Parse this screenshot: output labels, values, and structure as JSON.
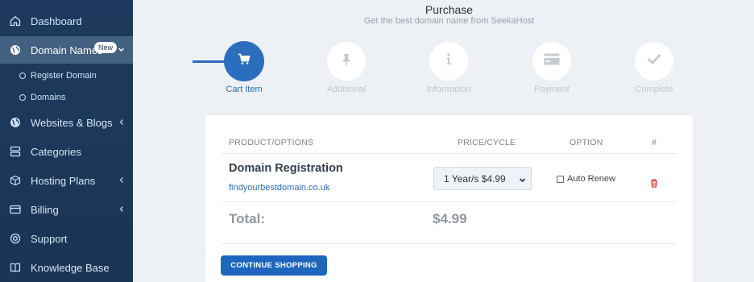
{
  "sidebar": {
    "items": [
      {
        "label": "Dashboard",
        "icon": "home-icon"
      },
      {
        "label": "Domain Names",
        "icon": "globe-icon",
        "badge": "New",
        "active": true
      },
      {
        "label": "Websites & Blogs",
        "icon": "globe-icon"
      },
      {
        "label": "Categories",
        "icon": "server-icon"
      },
      {
        "label": "Hosting Plans",
        "icon": "box-icon"
      },
      {
        "label": "Billing",
        "icon": "card-icon"
      },
      {
        "label": "Support",
        "icon": "lifebuoy-icon"
      },
      {
        "label": "Knowledge Base",
        "icon": "book-icon"
      }
    ],
    "subitems": [
      {
        "label": "Register Domain"
      },
      {
        "label": "Domains"
      }
    ]
  },
  "header": {
    "title": "Purchase",
    "subtitle": "Get the best domain name from SeekaHost"
  },
  "steps": [
    {
      "label": "Cart Item",
      "icon": "cart-icon",
      "active": true
    },
    {
      "label": "Additional",
      "icon": "pin-icon"
    },
    {
      "label": "Information",
      "icon": "info-icon"
    },
    {
      "label": "Payment",
      "icon": "credit-card-icon"
    },
    {
      "label": "Complete",
      "icon": "check-icon"
    }
  ],
  "cart": {
    "headers": {
      "product": "PRODUCT/OPTIONS",
      "price": "PRICE/CYCLE",
      "option": "OPTION",
      "hash": "#"
    },
    "item": {
      "name": "Domain Registration",
      "domain": "findyourbestdomain.co.uk",
      "cycle": "1 Year/s $4.99",
      "option_label": "Auto Renew",
      "auto_renew_checked": false
    },
    "total_label": "Total:",
    "total_value": "$4.99",
    "continue_label": "CONTINUE SHOPPING"
  },
  "colors": {
    "accent": "#2a6ebd",
    "sidebar": "#1d3a5e",
    "delete": "#e03b3b"
  }
}
